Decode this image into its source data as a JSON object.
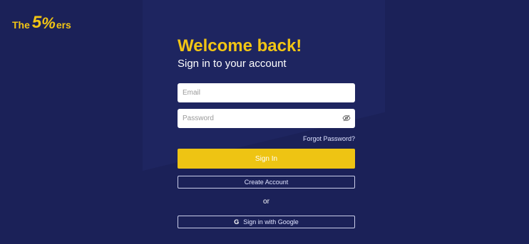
{
  "brand": {
    "logo_prefix": "The",
    "logo_number": "5",
    "logo_symbol": "%",
    "logo_suffix": "ers"
  },
  "login": {
    "title": "Welcome back!",
    "subtitle": "Sign in to your account",
    "email_placeholder": "Email",
    "email_value": "",
    "password_placeholder": "Password",
    "password_value": "",
    "forgot_password": "Forgot Password?",
    "sign_in": "Sign In",
    "create_account": "Create Account",
    "or_separator": "or",
    "google_icon_glyph": "G",
    "google_sign_in": "Sign in with Google"
  },
  "colors": {
    "background": "#1b2158",
    "accent": "#f2c514",
    "button_primary": "#eec413"
  },
  "icons": {
    "password_toggle": "eye-slash-icon",
    "google": "google-icon"
  }
}
